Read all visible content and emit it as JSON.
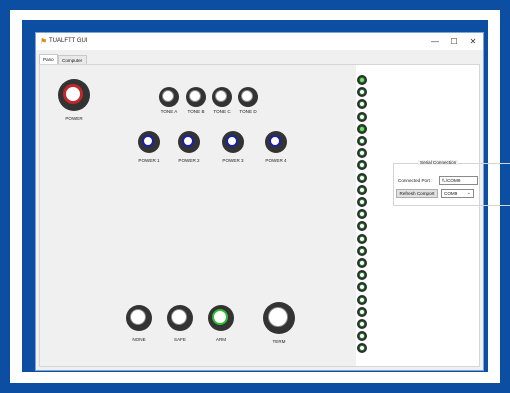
{
  "window": {
    "title": "TUALFTT GUI",
    "minimize_glyph": "—",
    "maximize_glyph": "☐",
    "close_glyph": "✕",
    "app_icon": "flag-icon"
  },
  "tabs": [
    {
      "label": "Pano",
      "active": true
    },
    {
      "label": "Computer",
      "active": false
    }
  ],
  "power": {
    "label": "POWER",
    "ring_color": "#c0282a"
  },
  "tones": [
    {
      "label": "TONE A"
    },
    {
      "label": "TONE B"
    },
    {
      "label": "TONE C"
    },
    {
      "label": "TONE D"
    }
  ],
  "power_channels": [
    {
      "label": "POWER 1",
      "ring_color": "#1a22a8"
    },
    {
      "label": "POWER 2",
      "ring_color": "#1a22a8"
    },
    {
      "label": "POWER 3",
      "ring_color": "#1a22a8"
    },
    {
      "label": "POWER 4",
      "ring_color": "#1a22a8"
    }
  ],
  "modes": [
    {
      "label": "NONE"
    },
    {
      "label": "SAFE"
    },
    {
      "label": "ARM",
      "ring_color": "#2fbd2f"
    },
    {
      "label": "TERM"
    }
  ],
  "leds": [
    true,
    false,
    false,
    false,
    true,
    false,
    false,
    false,
    false,
    false,
    false,
    false,
    false,
    false,
    false,
    false,
    false,
    false,
    false,
    false,
    false,
    false,
    false
  ],
  "serial": {
    "group_title": "Serial Connection",
    "connected_port_label": "Connected Port :",
    "connected_port_value": "\\\\.\\COM9",
    "refresh_button": "Refresh Comport",
    "selected_port": "COM9"
  }
}
